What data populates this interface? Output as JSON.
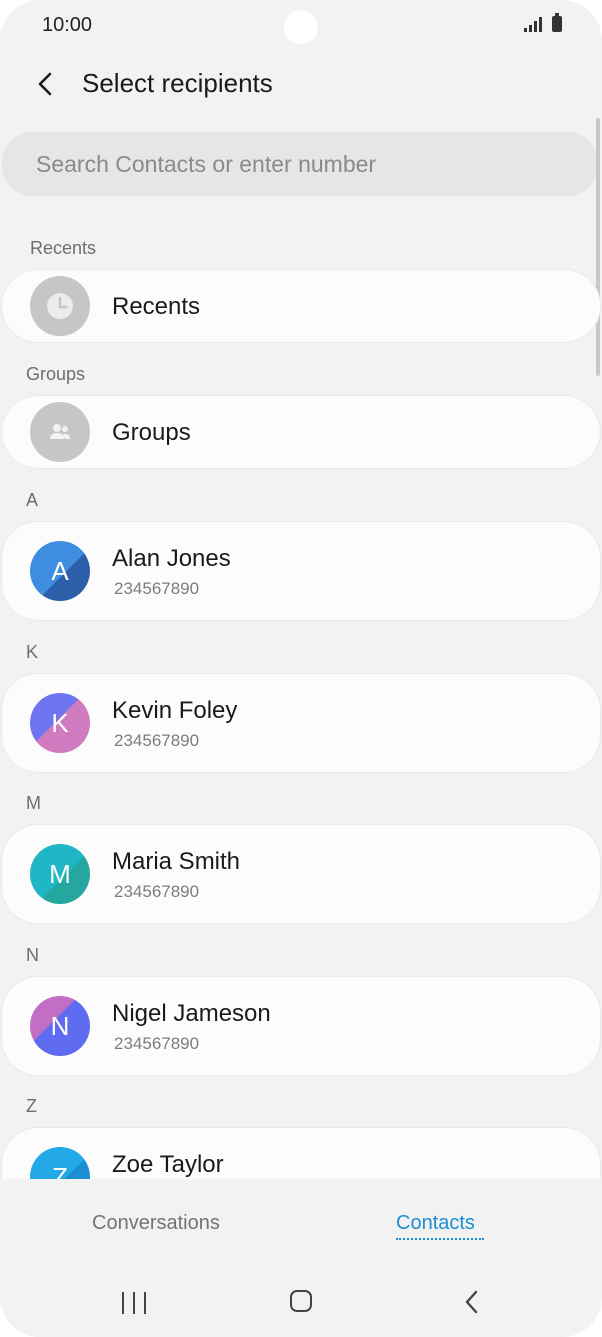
{
  "status_bar": {
    "time": "10:00"
  },
  "header": {
    "title": "Select recipients"
  },
  "search": {
    "placeholder": "Search Contacts or enter number"
  },
  "sections": {
    "recents_label": "Recents",
    "recents_item": "Recents",
    "groups_label": "Groups",
    "groups_item": "Groups"
  },
  "contacts": [
    {
      "letter": "A",
      "initial": "A",
      "name": "Alan Jones",
      "number": "234567890",
      "colors": [
        "#3f8de0",
        "#2d5fa8"
      ]
    },
    {
      "letter": "K",
      "initial": "K",
      "name": "Kevin Foley",
      "number": "234567890",
      "colors": [
        "#6f74f0",
        "#d07ac0"
      ]
    },
    {
      "letter": "M",
      "initial": "M",
      "name": "Maria Smith",
      "number": "234567890",
      "colors": [
        "#1fb6c6",
        "#25a7a0"
      ]
    },
    {
      "letter": "N",
      "initial": "N",
      "name": "Nigel Jameson",
      "number": "234567890",
      "colors": [
        "#c26ec4",
        "#5f6bf0"
      ]
    },
    {
      "letter": "Z",
      "initial": "Z",
      "name": "Zoe Taylor",
      "number": "",
      "colors": [
        "#23a9e6",
        "#1b8ed0"
      ]
    }
  ],
  "tabs": {
    "conversations": "Conversations",
    "contacts": "Contacts"
  },
  "colors": {
    "accent": "#1a8fd0",
    "background": "#f2f2f2"
  },
  "icons": {
    "back": "arrow-left-icon",
    "recents": "clock-icon",
    "groups": "people-icon",
    "nav_recents": "recent-apps-icon",
    "nav_home": "home-icon",
    "nav_back": "back-nav-icon"
  }
}
